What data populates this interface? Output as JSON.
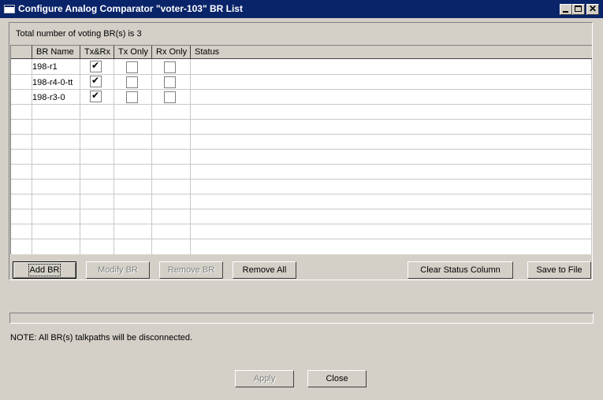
{
  "window": {
    "title": "Configure Analog Comparator \"voter-103\" BR List",
    "icons": [
      "app-icon",
      "minimize-icon",
      "maximize-icon",
      "close-icon"
    ]
  },
  "summary": "Total number of voting BR(s) is 3",
  "table": {
    "columns": [
      "BR Name",
      "Tx&Rx",
      "Tx Only",
      "Rx Only",
      "Status"
    ],
    "rows": [
      {
        "name": "198-r1",
        "txrx": true,
        "tx_only": false,
        "rx_only": false,
        "status": ""
      },
      {
        "name": "198-r4-0-tt",
        "txrx": true,
        "tx_only": false,
        "rx_only": false,
        "status": ""
      },
      {
        "name": "198-r3-0",
        "txrx": true,
        "tx_only": false,
        "rx_only": false,
        "status": ""
      }
    ]
  },
  "buttons": {
    "add_br": "Add BR",
    "modify_br": "Modify BR",
    "remove_br": "Remove BR",
    "remove_all": "Remove All",
    "clear_status": "Clear Status Column",
    "save_to_file": "Save to File",
    "apply": "Apply",
    "close": "Close"
  },
  "note": "NOTE: All BR(s) talkpaths will be disconnected."
}
